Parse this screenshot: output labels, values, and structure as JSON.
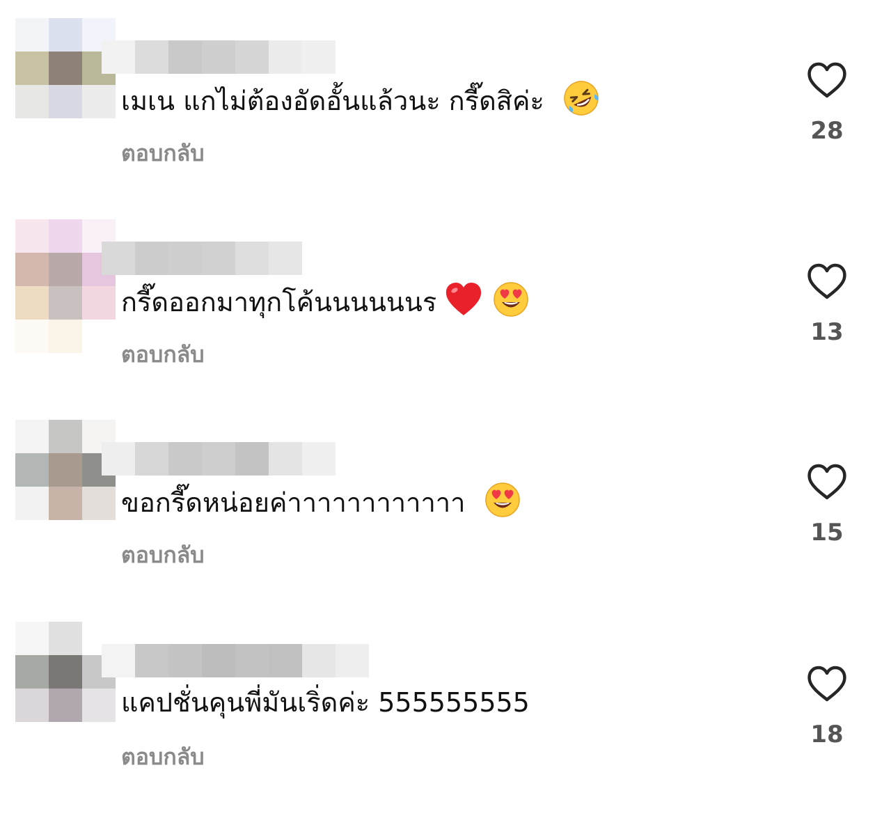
{
  "reply_label": "ตอบกลับ",
  "comments": [
    {
      "text": "เมเน แกไม่ต้องอัดอั้นแล้วนะ กรี๊ดสิค่ะ",
      "emojis": [
        "rolling-on-floor-laughing-emoji"
      ],
      "likes": "28",
      "avatar_pixels": [
        "#f3f4f7",
        "#dbe1ef",
        "#f1f4fb",
        "#c6c2a2",
        "#8e8178",
        "#b9b99a",
        "#e7e8e6",
        "#d8d9e3",
        "#ececec",
        "#ffffff",
        "#ffffff",
        "#ffffff"
      ],
      "username_pixels": [
        "#f2f2f2",
        "#dcdcdc",
        "#c9c9c9",
        "#cfcfcf",
        "#d6d6d6",
        "#ececec",
        "#f0f0f0"
      ]
    },
    {
      "text": "กรี๊ดออกมาทุกโค้นนนนนนร",
      "emojis": [
        "red-heart-emoji",
        "heart-eyes-emoji"
      ],
      "likes": "13",
      "avatar_pixels": [
        "#f7e6ee",
        "#efd8ee",
        "#faf1f8",
        "#d4b8ad",
        "#b9a9a9",
        "#e6c6de",
        "#eddcc2",
        "#c9c0c0",
        "#f2d7e0",
        "#fdfaf6",
        "#fbf5e9",
        "#ffffff"
      ],
      "username_pixels": [
        "#d9d9d9",
        "#cccccc",
        "#cfcfcf",
        "#d1d1d1",
        "#dedede",
        "#e6e6e6"
      ]
    },
    {
      "text": "ขอกรี๊ดหน่อยค่าาาาาาาาาาาา",
      "emojis": [
        "heart-eyes-emoji"
      ],
      "likes": "15",
      "avatar_pixels": [
        "#f4f4f4",
        "#c6c6c4",
        "#f5f4f3",
        "#b2b7b6",
        "#a99a90",
        "#8f8f8b",
        "#f2f2f2",
        "#c7b3a8",
        "#e4dedb",
        "#ffffff",
        "#ffffff",
        "#ffffff"
      ],
      "username_pixels": [
        "#eeeeee",
        "#d7d7d7",
        "#c9c9c9",
        "#cecece",
        "#c4c4c4",
        "#e4e4e4",
        "#f0f0f0"
      ]
    },
    {
      "text": "แคปชั่นคุนพี่มันเริ่ดค่ะ 555555555",
      "emojis": [],
      "likes": "18",
      "avatar_pixels": [
        "#f6f6f6",
        "#e1e1e1",
        "#ffffff",
        "#a7aaa4",
        "#7a7874",
        "#c8c8c8",
        "#dbd6d9",
        "#b0a8ae",
        "#e5e3e5",
        "#ffffff",
        "#ffffff",
        "#ffffff"
      ],
      "username_pixels": [
        "#f3f3f3",
        "#c8c8c8",
        "#c4c4c4",
        "#bdbdbd",
        "#c2c2c2",
        "#c0c0c0",
        "#e6e6e6",
        "#eeeeee"
      ]
    }
  ]
}
